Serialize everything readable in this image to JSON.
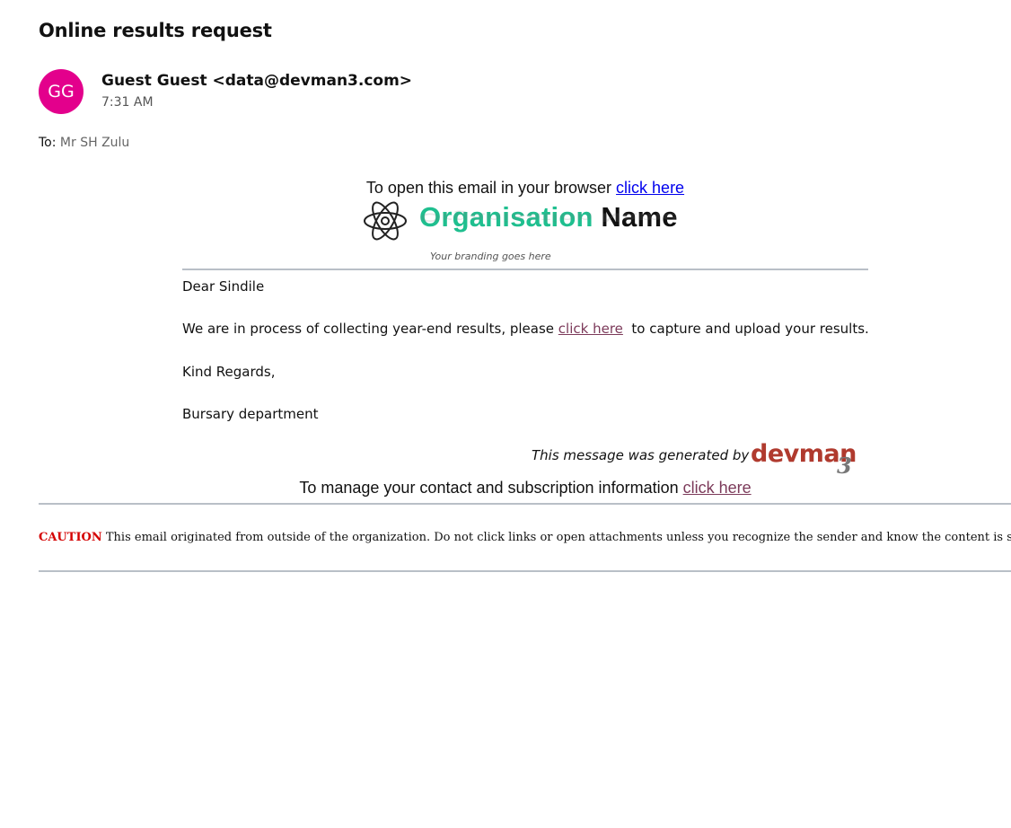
{
  "email": {
    "subject": "Online results request",
    "avatar_initials": "GG",
    "avatar_color": "#e3008c",
    "sender": "Guest Guest <data@devman3.com>",
    "time": "7:31 AM",
    "to_label": "To:",
    "to_value": "Mr SH Zulu"
  },
  "message": {
    "browser_prefix": "To open this email in your browser ",
    "browser_link": "click here",
    "logo": {
      "org_word": "Organisation",
      "name_word": "Name",
      "tagline": "Your branding goes here",
      "org_color": "#1fbf8f"
    },
    "greeting": "Dear Sindile",
    "para_prefix": "We are in process of collecting year-end results, please ",
    "para_link": "click here",
    "para_suffix": "  to capture and upload your results.",
    "regards": "Kind Regards,",
    "department": "Bursary department",
    "generated_by": "This message was generated by",
    "devman_word": "devman",
    "devman_num": "3",
    "manage_prefix": "To manage your contact and subscription information ",
    "manage_link": "click here"
  },
  "caution": {
    "label": "CAUTION",
    "text": " This email originated from outside of the organization. Do not click links or open attachments unless you recognize the sender and know the content is safe."
  }
}
